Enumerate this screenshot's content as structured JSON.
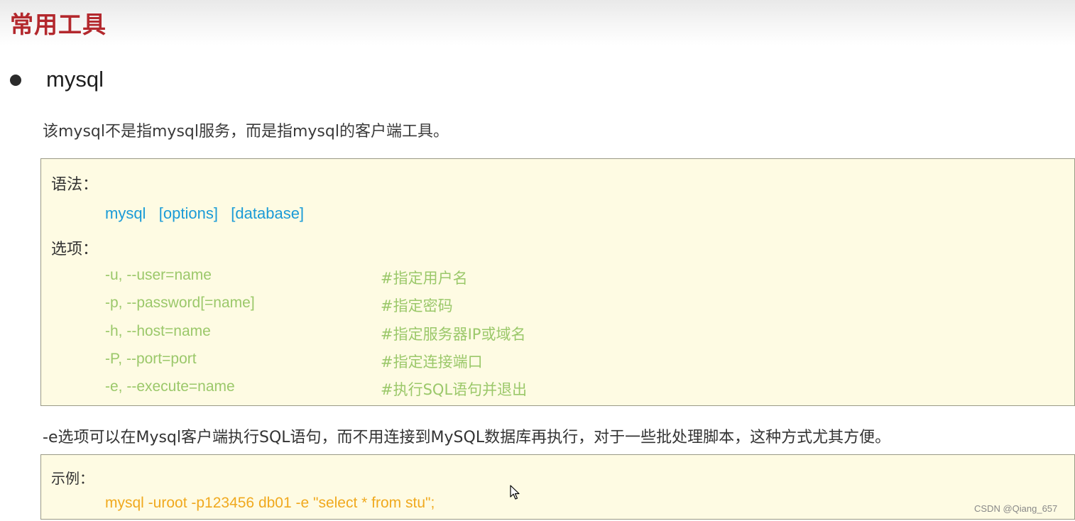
{
  "title": "常用工具",
  "section": {
    "heading": "mysql",
    "intro": "该mysql不是指mysql服务，而是指mysql的客户端工具。"
  },
  "syntax_box": {
    "syntax_label": "语法：",
    "syntax": "mysql   [options]   [database]",
    "options_label": "选项：",
    "options": [
      {
        "flag": "-u, --user=name",
        "desc": "#指定用户名"
      },
      {
        "flag": "-p, --password[=name]",
        "desc": "#指定密码"
      },
      {
        "flag": "-h, --host=name",
        "desc": "#指定服务器IP或域名"
      },
      {
        "flag": "-P, --port=port",
        "desc": "#指定连接端口"
      },
      {
        "flag": "-e, --execute=name",
        "desc": "#执行SQL语句并退出"
      }
    ]
  },
  "note": "-e选项可以在Mysql客户端执行SQL语句，而不用连接到MySQL数据库再执行，对于一些批处理脚本，这种方式尤其方便。",
  "example_box": {
    "label": "示例：",
    "command": "mysql -uroot -p123456 db01 -e \"select * from stu\";"
  },
  "watermark": "CSDN @Qiang_657",
  "colors": {
    "title": "#b3282d",
    "syntax": "#1a9bd7",
    "options": "#9bc86a",
    "command": "#f0a91e",
    "box_bg": "#fefbe3"
  }
}
